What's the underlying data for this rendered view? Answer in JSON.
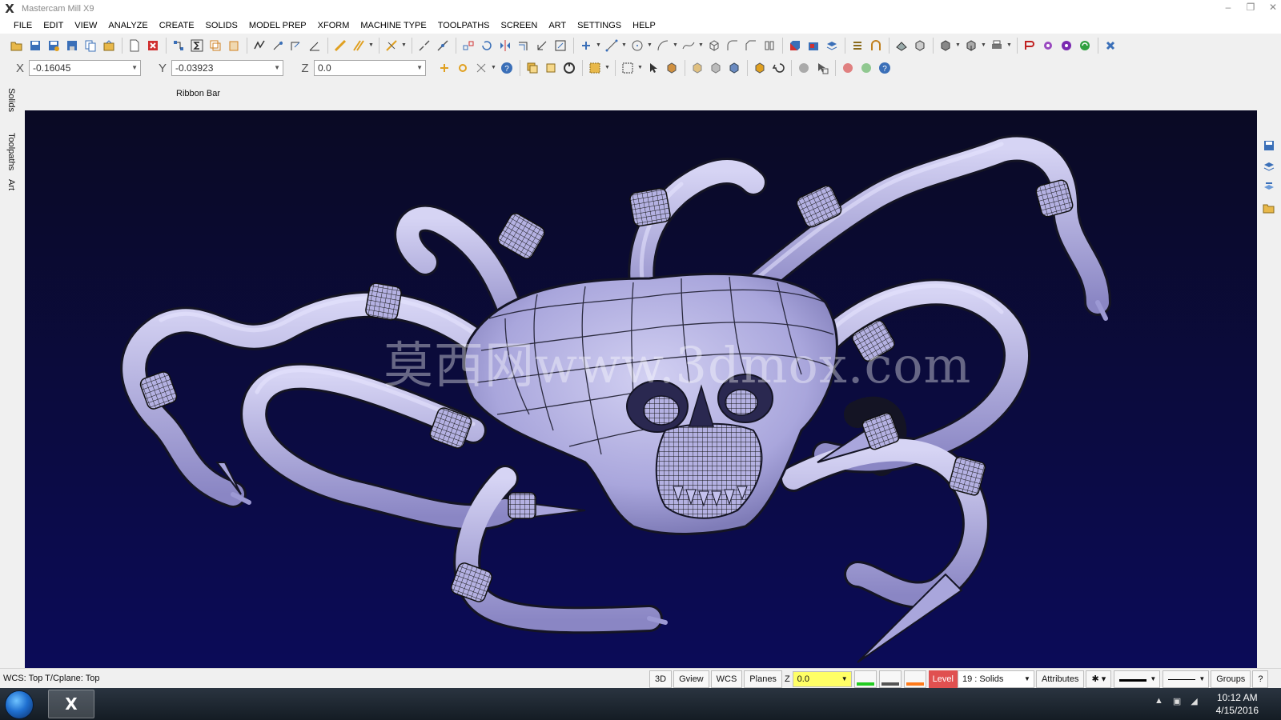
{
  "window": {
    "title": "Mastercam Mill X9",
    "controls": [
      "–",
      "❐",
      "✕"
    ]
  },
  "menu": [
    "FILE",
    "EDIT",
    "VIEW",
    "ANALYZE",
    "CREATE",
    "SOLIDS",
    "MODEL PREP",
    "XFORM",
    "MACHINE TYPE",
    "TOOLPATHS",
    "SCREEN",
    "ART",
    "SETTINGS",
    "HELP"
  ],
  "coords": {
    "x_label": "X",
    "x_value": "-0.16045",
    "y_label": "Y",
    "y_value": "-0.03923",
    "z_label": "Z",
    "z_value": "0.0"
  },
  "ribbon": {
    "label": "Ribbon Bar"
  },
  "left_tabs": [
    "Solids",
    "Toolpaths",
    "Art"
  ],
  "viewport": {
    "watermark": "莫西网www.3dmox.com",
    "model_color": "#b9b6e6",
    "bg_top": "#0a0a24",
    "bg_bottom": "#0b0b58"
  },
  "status": {
    "wcs_text": "WCS: Top  T/Cplane: Top",
    "btn_3d": "3D",
    "btn_gview": "Gview",
    "btn_wcs": "WCS",
    "btn_planes": "Planes",
    "z_label": "Z",
    "z_value": "0.0",
    "level_label": "Level",
    "level_value": "19 : Solids",
    "btn_attributes": "Attributes",
    "point_style": "✱",
    "btn_groups": "Groups",
    "btn_help": "?"
  },
  "taskbar": {
    "app_icon": "X",
    "time": "10:12 AM",
    "date": "4/15/2016"
  }
}
